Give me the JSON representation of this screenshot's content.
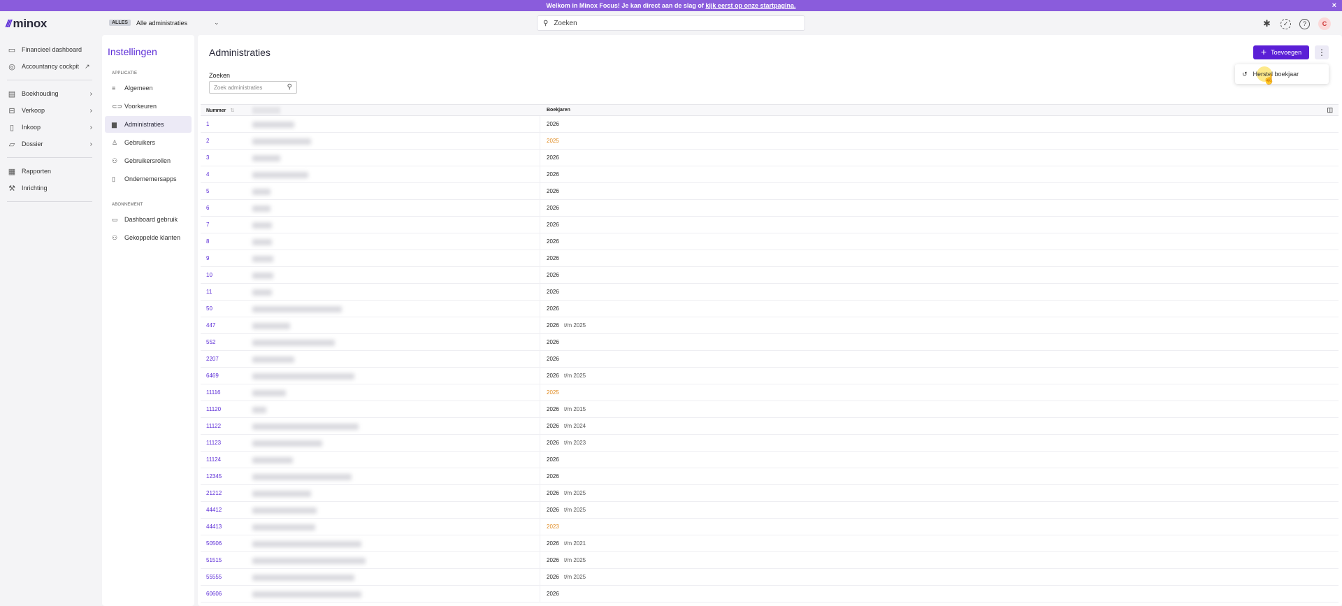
{
  "banner": {
    "text": "Welkom in Minox Focus! Je kan direct aan de slag of ",
    "link": "kijk eerst op onze startpagina.",
    "close": "×"
  },
  "header": {
    "logo_mark": "///",
    "logo_name": "minox",
    "admin_badge": "ALLES",
    "admin_label": "Alle administraties",
    "search_placeholder": "Zoeken",
    "avatar_initial": "C"
  },
  "sidebar": {
    "items": [
      {
        "label": "Financieel dashboard",
        "icon": "dashboard-icon"
      },
      {
        "label": "Accountancy cockpit",
        "icon": "compass-icon",
        "external": true
      },
      {
        "label": "Boekhouding",
        "icon": "book-icon",
        "arrow": true
      },
      {
        "label": "Verkoop",
        "icon": "cart-icon",
        "arrow": true
      },
      {
        "label": "Inkoop",
        "icon": "receipt-icon",
        "arrow": true
      },
      {
        "label": "Dossier",
        "icon": "folder-icon",
        "arrow": true
      },
      {
        "label": "Rapporten",
        "icon": "report-icon"
      },
      {
        "label": "Inrichting",
        "icon": "wrench-icon"
      }
    ]
  },
  "settings": {
    "title": "Instellingen",
    "group_app": "APPLICATIE",
    "app_items": [
      "Algemeen",
      "Voorkeuren",
      "Administraties",
      "Gebruikers",
      "Gebruikersrollen",
      "Ondernemersapps"
    ],
    "group_sub": "ABONNEMENT",
    "sub_items": [
      "Dashboard gebruik",
      "Gekoppelde klanten"
    ]
  },
  "main": {
    "title": "Administraties",
    "add_label": "Toevoegen",
    "menu_item": "Herstel boekjaar",
    "search_label": "Zoeken",
    "search_placeholder": "Zoek administraties",
    "col_number": "Nummer",
    "col_years": "Boekjaren"
  },
  "rows": [
    {
      "num": "1",
      "year": "2026",
      "range": "",
      "old": false,
      "w": 60
    },
    {
      "num": "2",
      "year": "2025",
      "range": "",
      "old": true,
      "w": 84
    },
    {
      "num": "3",
      "year": "2026",
      "range": "",
      "old": false,
      "w": 40
    },
    {
      "num": "4",
      "year": "2026",
      "range": "",
      "old": false,
      "w": 80
    },
    {
      "num": "5",
      "year": "2026",
      "range": "",
      "old": false,
      "w": 26
    },
    {
      "num": "6",
      "year": "2026",
      "range": "",
      "old": false,
      "w": 26
    },
    {
      "num": "7",
      "year": "2026",
      "range": "",
      "old": false,
      "w": 28
    },
    {
      "num": "8",
      "year": "2026",
      "range": "",
      "old": false,
      "w": 28
    },
    {
      "num": "9",
      "year": "2026",
      "range": "",
      "old": false,
      "w": 30
    },
    {
      "num": "10",
      "year": "2026",
      "range": "",
      "old": false,
      "w": 30
    },
    {
      "num": "11",
      "year": "2026",
      "range": "",
      "old": false,
      "w": 28
    },
    {
      "num": "50",
      "year": "2026",
      "range": "",
      "old": false,
      "w": 128
    },
    {
      "num": "447",
      "year": "2026",
      "range": "t/m 2025",
      "old": false,
      "w": 54
    },
    {
      "num": "552",
      "year": "2026",
      "range": "",
      "old": false,
      "w": 118
    },
    {
      "num": "2207",
      "year": "2026",
      "range": "",
      "old": false,
      "w": 60
    },
    {
      "num": "6469",
      "year": "2026",
      "range": "t/m 2025",
      "old": false,
      "w": 146
    },
    {
      "num": "11116",
      "year": "2025",
      "range": "",
      "old": true,
      "w": 48
    },
    {
      "num": "11120",
      "year": "2026",
      "range": "t/m 2015",
      "old": false,
      "w": 20
    },
    {
      "num": "11122",
      "year": "2026",
      "range": "t/m 2024",
      "old": false,
      "w": 152
    },
    {
      "num": "11123",
      "year": "2026",
      "range": "t/m 2023",
      "old": false,
      "w": 100
    },
    {
      "num": "11124",
      "year": "2026",
      "range": "",
      "old": false,
      "w": 58
    },
    {
      "num": "12345",
      "year": "2026",
      "range": "",
      "old": false,
      "w": 142
    },
    {
      "num": "21212",
      "year": "2026",
      "range": "t/m 2025",
      "old": false,
      "w": 84
    },
    {
      "num": "44412",
      "year": "2026",
      "range": "t/m 2025",
      "old": false,
      "w": 92
    },
    {
      "num": "44413",
      "year": "2023",
      "range": "",
      "old": true,
      "w": 90
    },
    {
      "num": "50506",
      "year": "2026",
      "range": "t/m 2021",
      "old": false,
      "w": 156
    },
    {
      "num": "51515",
      "year": "2026",
      "range": "t/m 2025",
      "old": false,
      "w": 162
    },
    {
      "num": "55555",
      "year": "2026",
      "range": "t/m 2025",
      "old": false,
      "w": 146
    },
    {
      "num": "60606",
      "year": "2026",
      "range": "",
      "old": false,
      "w": 156
    }
  ]
}
